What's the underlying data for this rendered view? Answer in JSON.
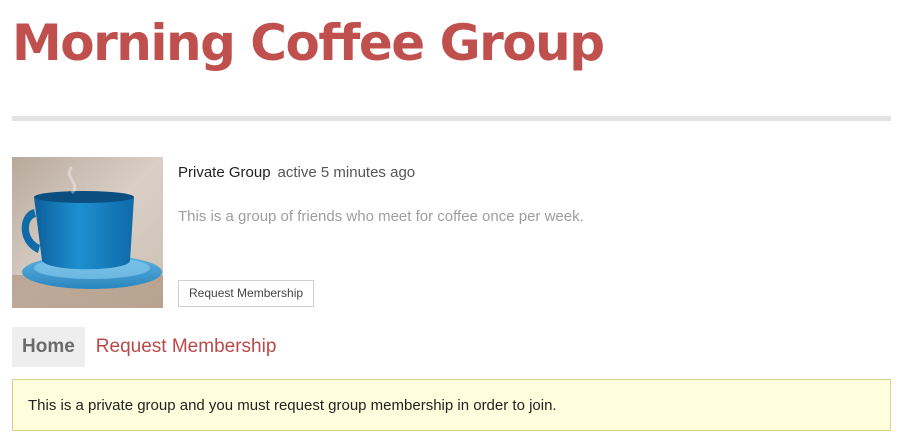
{
  "group": {
    "name": "Morning Coffee Group",
    "type": "Private Group",
    "activity": "active 5 minutes ago",
    "description": "This is a group of friends who meet for coffee once per week."
  },
  "actions": {
    "request_membership_button": "Request Membership"
  },
  "tabs": [
    {
      "label": "Home",
      "selected": true
    },
    {
      "label": "Request Membership",
      "selected": false
    }
  ],
  "notice": {
    "text": "This is a private group and you must request group membership in order to join."
  },
  "colors": {
    "title": "#c0504d",
    "link": "#b94a48",
    "notice_background": "#ffffdd"
  }
}
